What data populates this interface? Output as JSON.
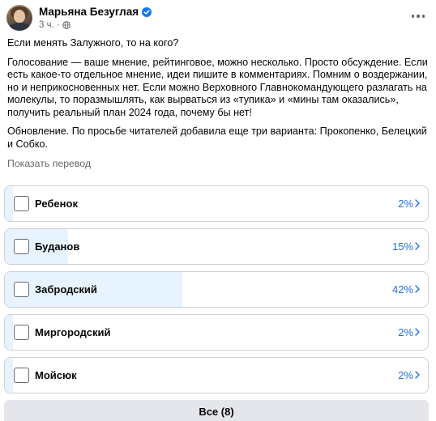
{
  "post": {
    "author": "Марьяна Безуглая",
    "time": "3 ч.",
    "title": "Если менять Залужного, то на кого?",
    "body": "Голосование — ваше мнение, рейтинговое, можно несколько.  Просто обсуждение.  Если есть какое-то отдельное мнение, идеи пишите в комментариях.  Помним о воздержании, но и неприкосновенных нет.  Если можно Верховного Главнокомандующего разлагать на молекулы, то поразмышлять, как вырваться из «тупика» и «мины там оказались», получить реальный план 2024 года, почему бы нет!",
    "update": "Обновление.  По просьбе читателей добавила еще три варианта: Прокопенко, Белецкий и Собко.",
    "translate_link": "Показать перевод"
  },
  "poll": {
    "options": [
      {
        "label": "Ребенок",
        "percent_text": "2%",
        "percent": 2
      },
      {
        "label": "Буданов",
        "percent_text": "15%",
        "percent": 15
      },
      {
        "label": "Забродский",
        "percent_text": "42%",
        "percent": 42
      },
      {
        "label": "Миргородский",
        "percent_text": "2%",
        "percent": 2
      },
      {
        "label": "Мойсюк",
        "percent_text": "2%",
        "percent": 2
      }
    ],
    "see_all_label": "Все (8)"
  },
  "colors": {
    "accent": "#216fdb",
    "verified": "#1877f2",
    "fill": "#e7f3ff",
    "muted": "#65676b"
  }
}
